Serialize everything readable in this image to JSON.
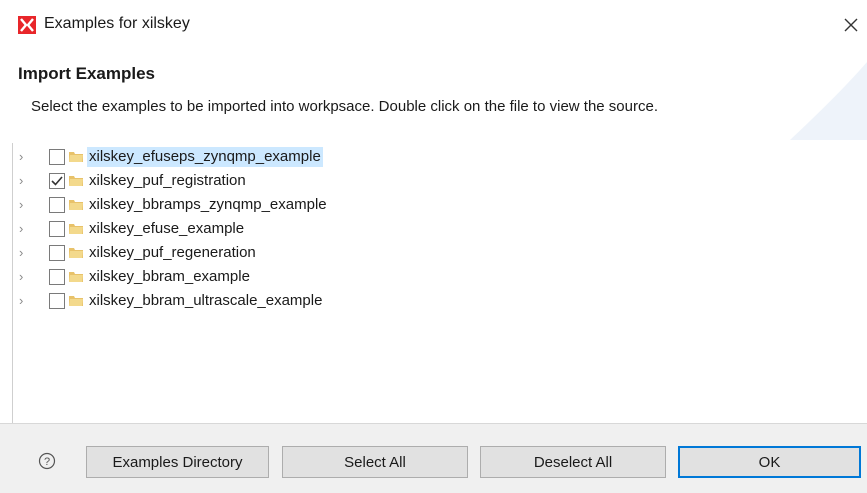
{
  "window": {
    "title": "Examples for xilskey",
    "app_icon": "xilinx-logo-icon",
    "close_icon": "close-icon",
    "accent_color": "#0078d7"
  },
  "header": {
    "title": "Import Examples",
    "description": "Select the examples to be imported into workpsace. Double click on the file to view the source."
  },
  "tree": {
    "items": [
      {
        "label": "xilskey_efuseps_zynqmp_example",
        "checked": false,
        "selected": true,
        "icon": "folder-icon"
      },
      {
        "label": "xilskey_puf_registration",
        "checked": true,
        "selected": false,
        "icon": "folder-icon"
      },
      {
        "label": "xilskey_bbramps_zynqmp_example",
        "checked": false,
        "selected": false,
        "icon": "folder-icon"
      },
      {
        "label": "xilskey_efuse_example",
        "checked": false,
        "selected": false,
        "icon": "folder-icon"
      },
      {
        "label": "xilskey_puf_regeneration",
        "checked": false,
        "selected": false,
        "icon": "folder-icon"
      },
      {
        "label": "xilskey_bbram_example",
        "checked": false,
        "selected": false,
        "icon": "folder-icon"
      },
      {
        "label": "xilskey_bbram_ultrascale_example",
        "checked": false,
        "selected": false,
        "icon": "folder-icon"
      }
    ]
  },
  "footer": {
    "help_icon": "help-icon",
    "examples_directory_label": "Examples Directory",
    "select_all_label": "Select All",
    "deselect_all_label": "Deselect All",
    "ok_label": "OK"
  }
}
